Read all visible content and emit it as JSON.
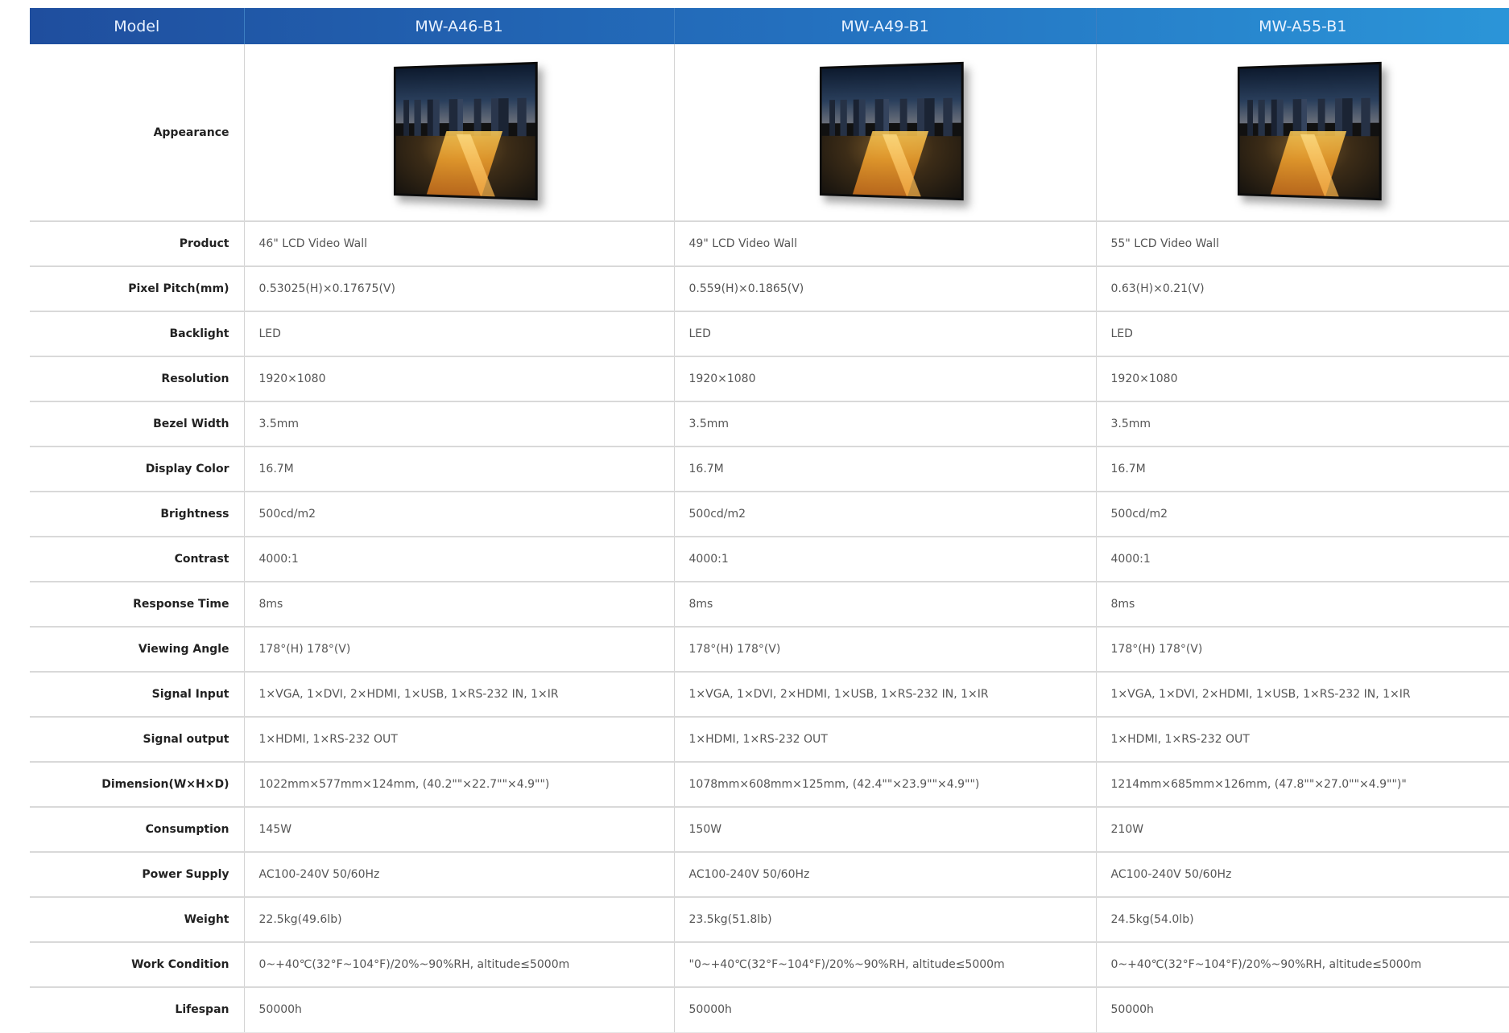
{
  "header": {
    "model_label": "Model",
    "models": [
      "MW-A46-B1",
      "MW-A49-B1",
      "MW-A55-B1"
    ]
  },
  "appearance": {
    "label": "Appearance",
    "image_icon": "lcd-video-wall-panel-image"
  },
  "rows": [
    {
      "label": "Product",
      "values": [
        "46\" LCD Video Wall",
        "49\" LCD Video Wall",
        "55\" LCD Video Wall"
      ]
    },
    {
      "label": "Pixel Pitch(mm)",
      "values": [
        "0.53025(H)×0.17675(V)",
        "0.559(H)×0.1865(V)",
        "0.63(H)×0.21(V)"
      ]
    },
    {
      "label": "Backlight",
      "values": [
        "LED",
        "LED",
        "LED"
      ]
    },
    {
      "label": "Resolution",
      "values": [
        "1920×1080",
        "1920×1080",
        "1920×1080"
      ]
    },
    {
      "label": "Bezel Width",
      "values": [
        "3.5mm",
        "3.5mm",
        "3.5mm"
      ]
    },
    {
      "label": "Display Color",
      "values": [
        "16.7M",
        "16.7M",
        "16.7M"
      ]
    },
    {
      "label": "Brightness",
      "values": [
        "500cd/m2",
        "500cd/m2",
        "500cd/m2"
      ]
    },
    {
      "label": "Contrast",
      "values": [
        "4000:1",
        "4000:1",
        "4000:1"
      ]
    },
    {
      "label": "Response Time",
      "values": [
        "8ms",
        "8ms",
        "8ms"
      ]
    },
    {
      "label": "Viewing Angle",
      "values": [
        "178°(H) 178°(V)",
        "178°(H) 178°(V)",
        "178°(H) 178°(V)"
      ]
    },
    {
      "label": "Signal Input",
      "values": [
        "1×VGA, 1×DVI, 2×HDMI, 1×USB, 1×RS-232 IN, 1×IR",
        "1×VGA, 1×DVI, 2×HDMI, 1×USB, 1×RS-232 IN, 1×IR",
        "1×VGA, 1×DVI, 2×HDMI, 1×USB, 1×RS-232 IN, 1×IR"
      ]
    },
    {
      "label": "Signal output",
      "values": [
        "1×HDMI, 1×RS-232 OUT",
        "1×HDMI, 1×RS-232 OUT",
        "1×HDMI, 1×RS-232 OUT"
      ]
    },
    {
      "label": "Dimension(W×H×D)",
      "values": [
        "1022mm×577mm×124mm, (40.2\"\"×22.7\"\"×4.9\"\")",
        "1078mm×608mm×125mm, (42.4\"\"×23.9\"\"×4.9\"\")",
        "1214mm×685mm×126mm, (47.8\"\"×27.0\"\"×4.9\"\")\""
      ]
    },
    {
      "label": "Consumption",
      "values": [
        "145W",
        "150W",
        "210W"
      ]
    },
    {
      "label": "Power Supply",
      "values": [
        "AC100-240V 50/60Hz",
        "AC100-240V 50/60Hz",
        "AC100-240V 50/60Hz"
      ]
    },
    {
      "label": "Weight",
      "values": [
        "22.5kg(49.6lb)",
        "23.5kg(51.8lb)",
        "24.5kg(54.0lb)"
      ]
    },
    {
      "label": "Work Condition",
      "values": [
        "0~+40℃(32°F~104°F)/20%~90%RH, altitude≤5000m",
        "\"0~+40℃(32°F~104°F)/20%~90%RH, altitude≤5000m",
        "0~+40℃(32°F~104°F)/20%~90%RH, altitude≤5000m"
      ]
    },
    {
      "label": "Lifespan",
      "values": [
        "50000h",
        "50000h",
        "50000h"
      ]
    }
  ]
}
